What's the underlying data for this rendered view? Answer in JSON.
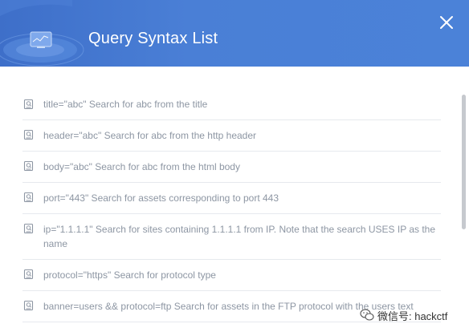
{
  "dialog": {
    "title": "Query Syntax List",
    "header_color": "#4a7fd6",
    "close_icon": "close-icon"
  },
  "syntax_items": [
    {
      "text": "title=\"abc\" Search for abc from the title",
      "icon": "document-search-icon"
    },
    {
      "text": "header=\"abc\" Search for abc from the http header",
      "icon": "document-search-icon"
    },
    {
      "text": "body=\"abc\" Search for abc from the html body",
      "icon": "document-search-icon"
    },
    {
      "text": "port=\"443\" Search for assets corresponding to port 443",
      "icon": "document-search-icon"
    },
    {
      "text": "ip=\"1.1.1.1\" Search for sites containing 1.1.1.1 from IP. Note that the search USES IP as the name",
      "icon": "document-search-icon"
    },
    {
      "text": "protocol=\"https\" Search for protocol type",
      "icon": "document-search-icon"
    },
    {
      "text": "banner=users && protocol=ftp Search for assets in the FTP protocol with the users text",
      "icon": "document-search-icon"
    }
  ],
  "watermark": {
    "text": "微信号: hackctf",
    "icon": "wechat-icon"
  }
}
